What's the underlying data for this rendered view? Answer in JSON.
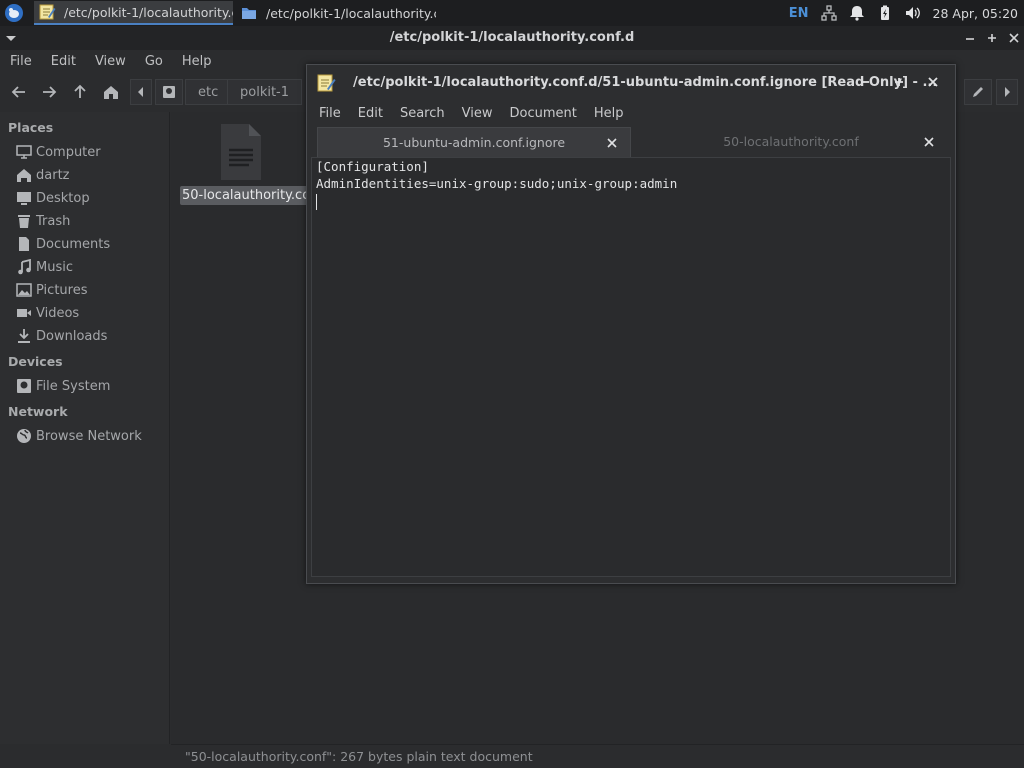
{
  "panel": {
    "start_icon": "xfce-mouse-icon",
    "tasks": [
      {
        "icon": "text-editor-icon",
        "label": "/etc/polkit-1/localauthority.c..."
      },
      {
        "icon": "folder-icon",
        "label": "/etc/polkit-1/localauthority.c..."
      }
    ],
    "tray": {
      "language": "EN",
      "icons": [
        "network-icon",
        "notification-bell-icon",
        "battery-icon",
        "volume-icon"
      ],
      "clock": "28 Apr, 05:20"
    }
  },
  "file_manager": {
    "title": "/etc/polkit-1/localauthority.conf.d",
    "menu": [
      "File",
      "Edit",
      "View",
      "Go",
      "Help"
    ],
    "toolbar": {
      "nav_icons": [
        "back-arrow-icon",
        "forward-arrow-icon",
        "up-arrow-icon",
        "home-icon"
      ],
      "breadcrumb": [
        "etc",
        "polkit-1"
      ]
    },
    "sidebar": {
      "places_heading": "Places",
      "places": [
        {
          "icon": "computer-icon",
          "label": "Computer"
        },
        {
          "icon": "home-icon",
          "label": "dartz"
        },
        {
          "icon": "desktop-icon",
          "label": "Desktop"
        },
        {
          "icon": "trash-icon",
          "label": "Trash"
        },
        {
          "icon": "documents-icon",
          "label": "Documents"
        },
        {
          "icon": "music-icon",
          "label": "Music"
        },
        {
          "icon": "pictures-icon",
          "label": "Pictures"
        },
        {
          "icon": "videos-icon",
          "label": "Videos"
        },
        {
          "icon": "downloads-icon",
          "label": "Downloads"
        }
      ],
      "devices_heading": "Devices",
      "devices": [
        {
          "icon": "drive-icon",
          "label": "File System"
        }
      ],
      "network_heading": "Network",
      "network": [
        {
          "icon": "globe-icon",
          "label": "Browse Network"
        }
      ]
    },
    "files": [
      {
        "icon": "text-file-icon",
        "label": "50-localauthority.conf"
      }
    ],
    "status": "\"50-localauthority.conf\": 267 bytes plain text document"
  },
  "editor": {
    "title": "/etc/polkit-1/localauthority.conf.d/51-ubuntu-admin.conf.ignore [Read Only] - ...",
    "menu": [
      "File",
      "Edit",
      "Search",
      "View",
      "Document",
      "Help"
    ],
    "tabs": [
      {
        "label": "51-ubuntu-admin.conf.ignore",
        "active": true
      },
      {
        "label": "50-localauthority.conf",
        "active": false
      }
    ],
    "lines": [
      "[Configuration]",
      "AdminIdentities=unix-group:sudo;unix-group:admin"
    ]
  }
}
